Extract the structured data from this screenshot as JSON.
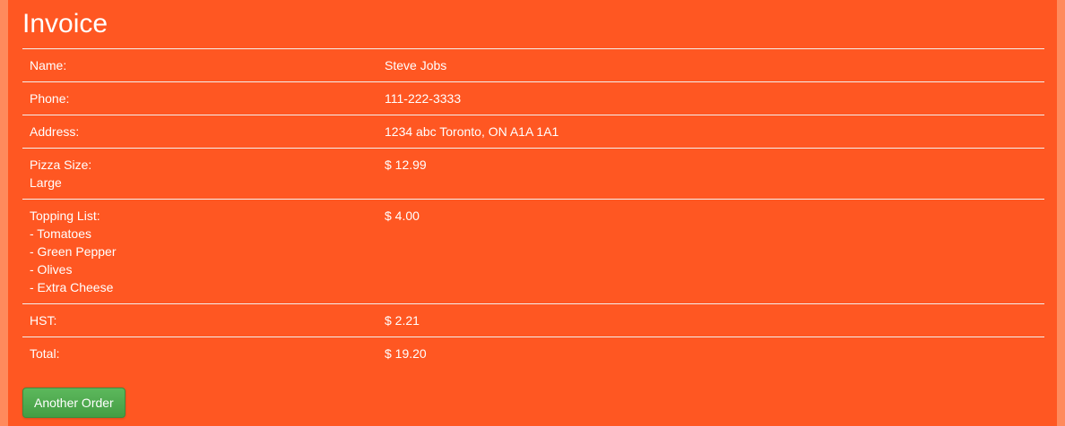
{
  "page": {
    "title": "Invoice"
  },
  "invoice": {
    "name_label": "Name:",
    "name_value": "Steve Jobs",
    "phone_label": "Phone:",
    "phone_value": "111-222-3333",
    "address_label": "Address:",
    "address_value": "1234 abc Toronto, ON A1A 1A1",
    "pizza_size_label": "Pizza Size:",
    "pizza_size_value": "Large",
    "pizza_size_price": "$ 12.99",
    "topping_label": "Topping List:",
    "toppings": [
      "- Tomatoes",
      "- Green Pepper",
      "- Olives",
      "- Extra Cheese"
    ],
    "topping_price": "$ 4.00",
    "hst_label": "HST:",
    "hst_value": "$ 2.21",
    "total_label": "Total:",
    "total_value": "$ 19.20"
  },
  "actions": {
    "another_order_label": "Another Order"
  },
  "colors": {
    "panel_background": "#ff5722",
    "page_background": "#ff8a5c",
    "button_green": "#4cae4c"
  }
}
